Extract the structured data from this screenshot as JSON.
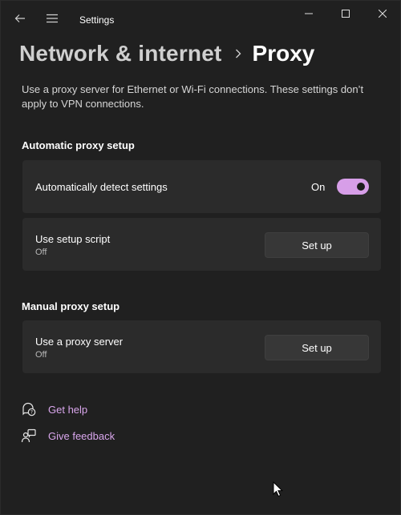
{
  "window": {
    "app_title": "Settings",
    "back_icon": "back-arrow-icon",
    "menu_icon": "hamburger-menu-icon",
    "controls": [
      "minimize-icon",
      "maximize-icon",
      "close-icon"
    ]
  },
  "header": {
    "parent": "Network & internet",
    "separator_icon": "chevron-right-icon",
    "current": "Proxy"
  },
  "description": "Use a proxy server for Ethernet or Wi-Fi connections. These settings don’t apply to VPN connections.",
  "automatic": {
    "title": "Automatic proxy setup",
    "detect": {
      "label": "Automatically detect settings",
      "state": "On",
      "toggle_on": true
    },
    "script": {
      "label": "Use setup script",
      "sublabel": "Off",
      "button": "Set up"
    }
  },
  "manual": {
    "title": "Manual proxy setup",
    "proxy": {
      "label": "Use a proxy server",
      "sublabel": "Off",
      "button": "Set up"
    }
  },
  "links": {
    "help": "Get help",
    "feedback": "Give feedback"
  },
  "colors": {
    "background": "#202020",
    "card": "#2b2b2b",
    "accent": "#d79ee8",
    "link": "#d9a6ec"
  }
}
